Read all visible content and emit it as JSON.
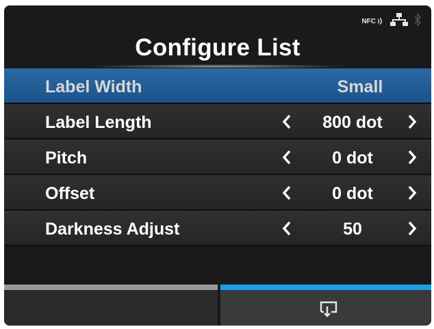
{
  "header": {
    "title": "Configure List",
    "status_icons": [
      "nfc-icon",
      "network-icon",
      "bluetooth-icon"
    ],
    "nfc_text": "NFC"
  },
  "list": {
    "items": [
      {
        "label": "Label Width",
        "value": "Small",
        "has_arrows": false,
        "selected": true
      },
      {
        "label": "Label Length",
        "value": "800 dot",
        "has_arrows": true,
        "selected": false
      },
      {
        "label": "Pitch",
        "value": "0 dot",
        "has_arrows": true,
        "selected": false
      },
      {
        "label": "Offset",
        "value": "0 dot",
        "has_arrows": true,
        "selected": false
      },
      {
        "label": "Darkness Adjust",
        "value": "50",
        "has_arrows": true,
        "selected": false
      }
    ]
  },
  "footer": {
    "right_tab_icon": "return-to-list-icon"
  },
  "colors": {
    "selection": "#1c5289",
    "active_tab": "#1aa0e6",
    "inactive_tab": "#9a9a9a"
  }
}
